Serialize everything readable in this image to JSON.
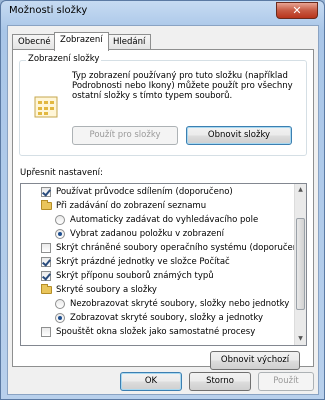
{
  "window": {
    "title": "Možnosti složky",
    "close_label": "✕"
  },
  "tabs": [
    {
      "label": "Obecné",
      "active": false
    },
    {
      "label": "Zobrazení",
      "active": true
    },
    {
      "label": "Hledání",
      "active": false
    }
  ],
  "folder_views": {
    "group_label": "Zobrazení složky",
    "description": [
      "Typ zobrazení používaný pro tuto složku (například",
      "Podrobnosti nebo Ikony) můžete použít pro všechny",
      "ostatní složky s tímto typem souborů."
    ],
    "apply_button": "Použít pro složky",
    "reset_button": "Obnovit složky"
  },
  "advanced": {
    "label": "Upřesnit nastavení:",
    "items": [
      {
        "type": "checkbox",
        "checked": true,
        "indent": 1,
        "label": "Používat průvodce sdílením (doporučeno)"
      },
      {
        "type": "folder",
        "indent": 1,
        "label": "Při zadávání do zobrazení seznamu"
      },
      {
        "type": "radio",
        "checked": false,
        "indent": 2,
        "label": "Automaticky zadávat do vyhledávacího pole"
      },
      {
        "type": "radio",
        "checked": true,
        "indent": 2,
        "label": "Vybrat zadanou položku v zobrazení"
      },
      {
        "type": "checkbox",
        "checked": false,
        "indent": 1,
        "label": "Skrýt chráněné soubory operačního systému (doporučeno)"
      },
      {
        "type": "checkbox",
        "checked": true,
        "indent": 1,
        "label": "Skrýt prázdné jednotky ve složce Počítač"
      },
      {
        "type": "checkbox",
        "checked": true,
        "indent": 1,
        "label": "Skrýt příponu souborů známých typů"
      },
      {
        "type": "folder",
        "indent": 1,
        "label": "Skryté soubory a složky"
      },
      {
        "type": "radio",
        "checked": false,
        "indent": 2,
        "label": "Nezobrazovat skryté soubory, složky nebo jednotky"
      },
      {
        "type": "radio",
        "checked": true,
        "indent": 2,
        "label": "Zobrazovat skryté soubory, složky a jednotky"
      },
      {
        "type": "checkbox",
        "checked": false,
        "indent": 1,
        "label": "Spouštět okna složek jako samostatné procesy"
      }
    ],
    "restore_button": "Obnovit výchozí"
  },
  "footer": {
    "ok": "OK",
    "cancel": "Storno",
    "apply": "Použít"
  }
}
